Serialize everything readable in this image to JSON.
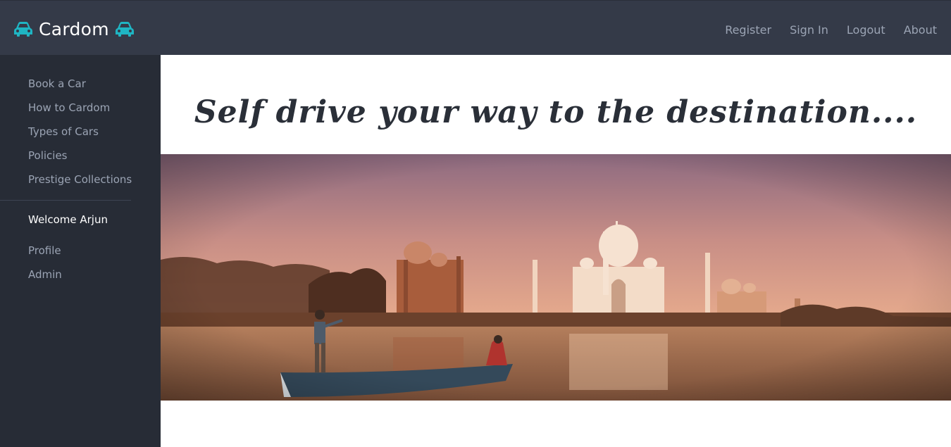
{
  "brand": {
    "name": "Cardom",
    "icon": "car-icon",
    "accent": "#1fb5c3"
  },
  "topnav": {
    "register": "Register",
    "sign_in": "Sign In",
    "logout": "Logout",
    "about": "About"
  },
  "sidebar": {
    "items": [
      {
        "label": "Book a Car"
      },
      {
        "label": "How to Cardom"
      },
      {
        "label": "Types of Cars"
      },
      {
        "label": "Policies"
      },
      {
        "label": "Prestige Collections"
      }
    ],
    "welcome": "Welcome Arjun",
    "user_items": [
      {
        "label": "Profile"
      },
      {
        "label": "Admin"
      }
    ]
  },
  "main": {
    "headline": "Self drive your way to the destination...."
  },
  "colors": {
    "topbar": "#343a48",
    "sidebar": "#272c36",
    "nav_text": "#9ba4b4"
  }
}
